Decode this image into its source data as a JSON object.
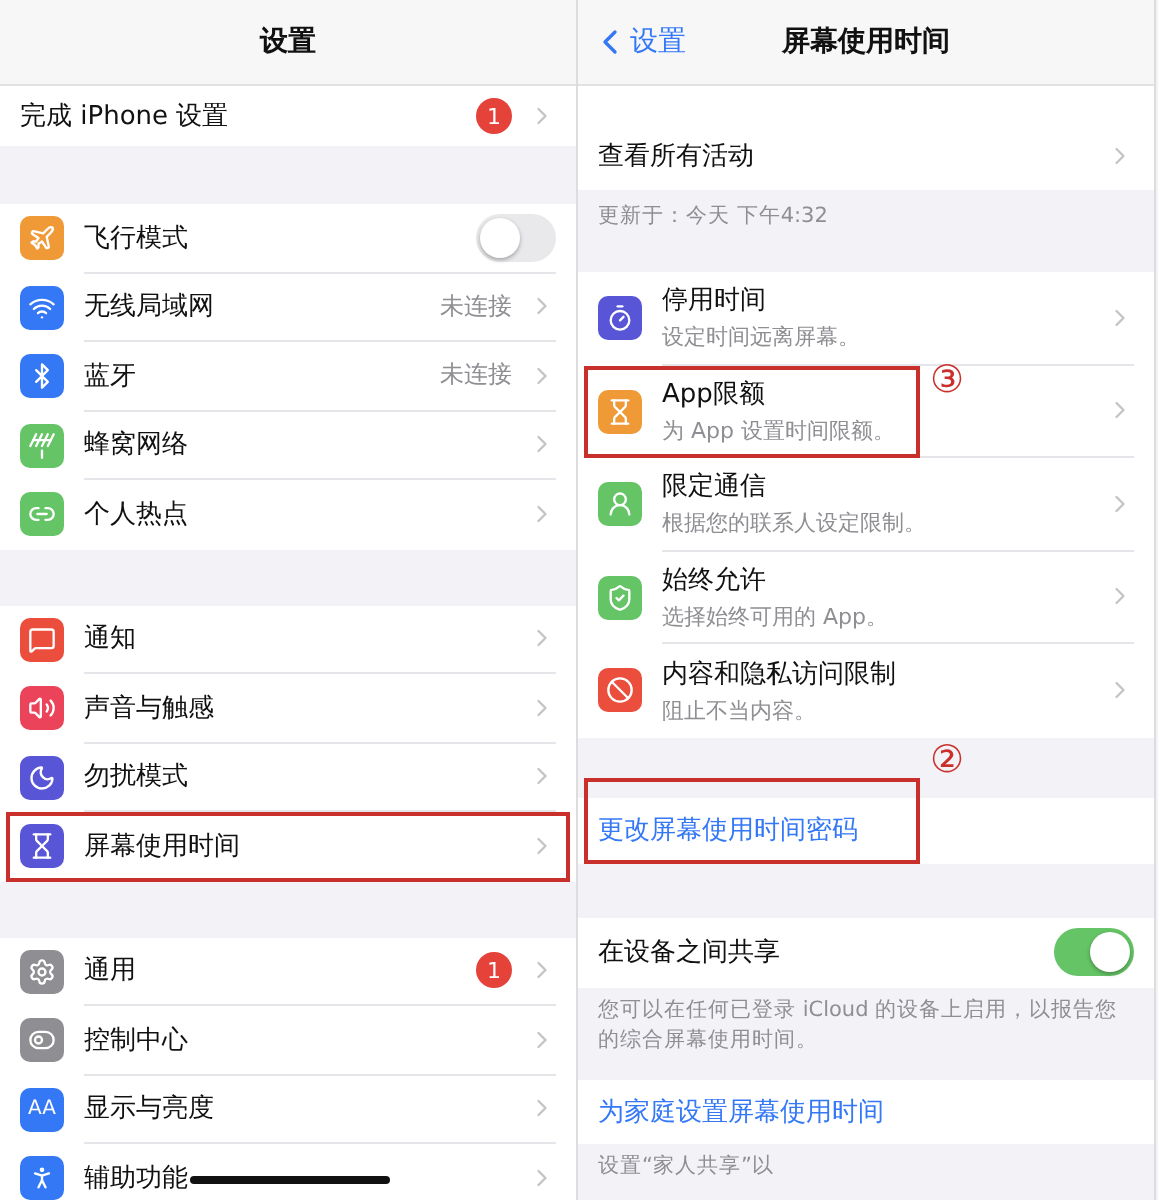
{
  "left_screen": {
    "title": "设置",
    "setup_row": {
      "label": "完成 iPhone 设置",
      "badge": "1"
    },
    "groups": [
      [
        {
          "color": "#f09a37",
          "label": "飞行模式",
          "kind": "toggle",
          "on": false,
          "highlighted": false
        },
        {
          "color": "#3478f6",
          "label": "无线局域网",
          "kind": "link",
          "value": "未连接",
          "highlighted": false
        },
        {
          "color": "#3478f6",
          "label": "蓝牙",
          "kind": "link",
          "value": "未连接",
          "highlighted": false
        },
        {
          "color": "#65c466",
          "label": "蜂窝网络",
          "kind": "link",
          "highlighted": false
        },
        {
          "color": "#65c466",
          "label": "个人热点",
          "kind": "link",
          "highlighted": false
        }
      ],
      [
        {
          "color": "#eb4e3d",
          "label": "通知",
          "kind": "link",
          "highlighted": false
        },
        {
          "color": "#eb445a",
          "label": "声音与触感",
          "kind": "link",
          "highlighted": false
        },
        {
          "color": "#5856d6",
          "label": "勿扰模式",
          "kind": "link",
          "highlighted": false
        },
        {
          "color": "#5856d6",
          "label": "屏幕使用时间",
          "kind": "link",
          "highlighted": true
        }
      ],
      [
        {
          "color": "#8e8e93",
          "label": "通用",
          "kind": "link",
          "badge": "1",
          "highlighted": false
        },
        {
          "color": "#8e8e93",
          "label": "控制中心",
          "kind": "link",
          "highlighted": false
        },
        {
          "icon_text": "AA",
          "color": "#3478f6",
          "label": "显示与亮度",
          "kind": "link",
          "highlighted": false
        },
        {
          "color": "#3478f6",
          "label": "辅助功能",
          "kind": "link",
          "highlighted": false
        }
      ]
    ]
  },
  "right_screen": {
    "back": "设置",
    "title": "屏幕使用时间",
    "activity_row": "查看所有活动",
    "updated": "更新于：今天 下午4:32",
    "features": [
      {
        "color": "#5856d6",
        "label": "停用时间",
        "subtitle": "设定时间远离屏幕。",
        "highlighted": false
      },
      {
        "color": "#f09a37",
        "label": "App限额",
        "subtitle": "为 App 设置时间限额。",
        "highlighted": true,
        "callout": "③"
      },
      {
        "color": "#65c466",
        "label": "限定通信",
        "subtitle": "根据您的联系人设定限制。",
        "highlighted": false
      },
      {
        "color": "#65c466",
        "label": "始终允许",
        "subtitle": "选择始终可用的 App。",
        "highlighted": false
      },
      {
        "color": "#eb4e3d",
        "label": "内容和隐私访问限制",
        "subtitle": "阻止不当内容。",
        "highlighted": false
      }
    ],
    "passcode": {
      "label": "更改屏幕使用时间密码",
      "highlighted": true,
      "callout": "②"
    },
    "share": {
      "label": "在设备之间共享",
      "on": true,
      "footer": "您可以在任何已登录 iCloud 的设备上启用，以报告您的综合屏幕使用时间。"
    },
    "family": {
      "label": "为家庭设置屏幕使用时间",
      "footer": "设置“家人共享”以"
    }
  }
}
